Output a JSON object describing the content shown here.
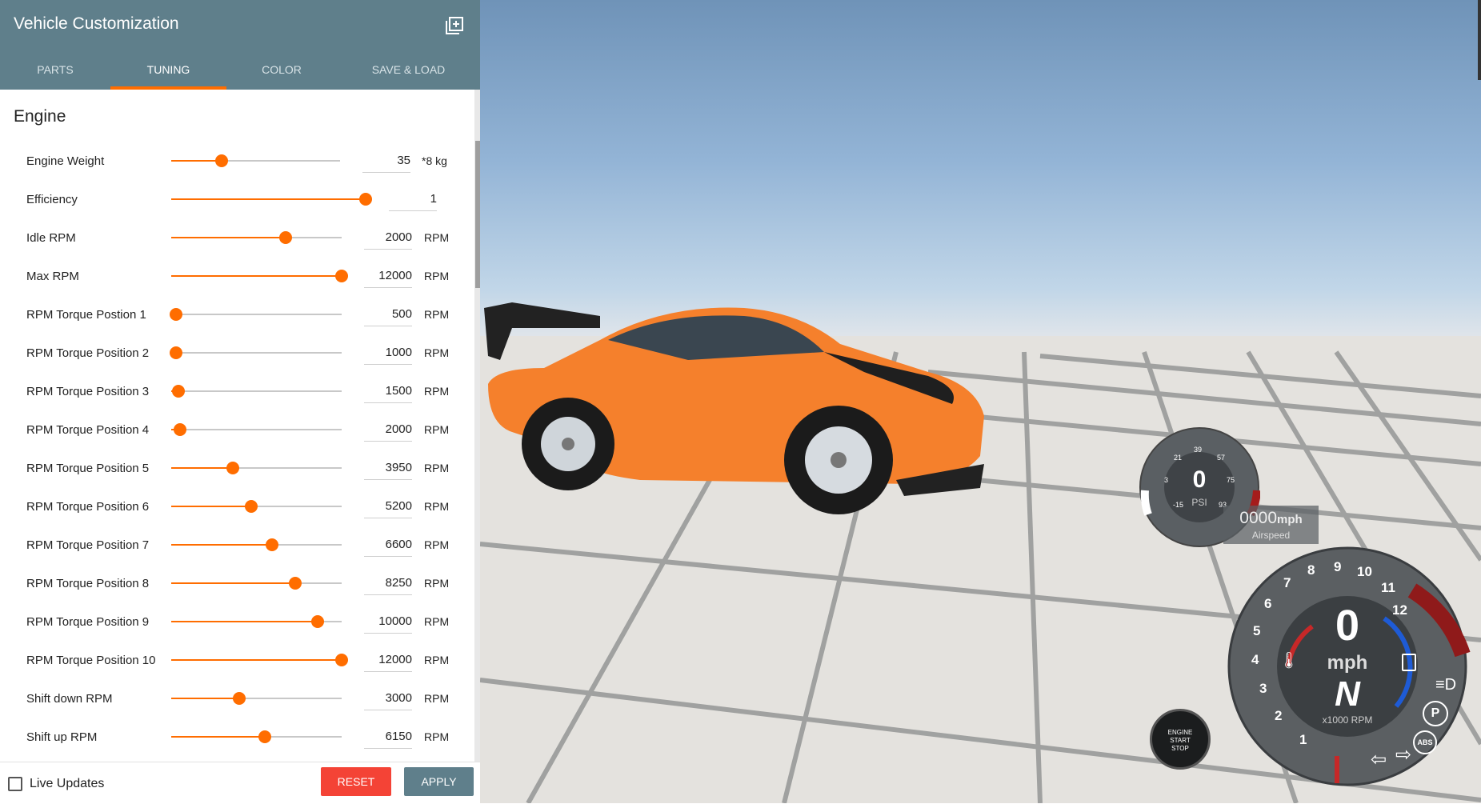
{
  "panel": {
    "title": "Vehicle Customization",
    "header_icon": "add-window-icon",
    "tabs": [
      {
        "label": "PARTS",
        "active": false
      },
      {
        "label": "TUNING",
        "active": true
      },
      {
        "label": "COLOR",
        "active": false
      },
      {
        "label": "SAVE & LOAD",
        "active": false
      }
    ],
    "section_title": "Engine",
    "accent_color": "#ff6d00",
    "header_color": "#5f7f8b",
    "settings": [
      {
        "label": "Engine Weight",
        "value": "35",
        "unit": "*8 kg",
        "level": 0.3
      },
      {
        "label": "Efficiency",
        "value": "1",
        "unit": "",
        "level": 1.0
      },
      {
        "label": "Idle RPM",
        "value": "2000",
        "unit": "RPM",
        "level": 0.67
      },
      {
        "label": "Max RPM",
        "value": "12000",
        "unit": "RPM",
        "level": 1.0
      },
      {
        "label": "RPM Torque Postion 1",
        "value": "500",
        "unit": "RPM",
        "level": 0.03
      },
      {
        "label": "RPM Torque Position 2",
        "value": "1000",
        "unit": "RPM",
        "level": 0.03
      },
      {
        "label": "RPM Torque Position 3",
        "value": "1500",
        "unit": "RPM",
        "level": 0.04
      },
      {
        "label": "RPM Torque Position 4",
        "value": "2000",
        "unit": "RPM",
        "level": 0.05
      },
      {
        "label": "RPM Torque Position 5",
        "value": "3950",
        "unit": "RPM",
        "level": 0.36
      },
      {
        "label": "RPM Torque Position 6",
        "value": "5200",
        "unit": "RPM",
        "level": 0.47
      },
      {
        "label": "RPM Torque Position 7",
        "value": "6600",
        "unit": "RPM",
        "level": 0.59
      },
      {
        "label": "RPM Torque Position 8",
        "value": "8250",
        "unit": "RPM",
        "level": 0.73
      },
      {
        "label": "RPM Torque Position 9",
        "value": "10000",
        "unit": "RPM",
        "level": 0.86
      },
      {
        "label": "RPM Torque Position 10",
        "value": "12000",
        "unit": "RPM",
        "level": 1.0
      },
      {
        "label": "Shift down RPM",
        "value": "3000",
        "unit": "RPM",
        "level": 0.4
      },
      {
        "label": "Shift up RPM",
        "value": "6150",
        "unit": "RPM",
        "level": 0.55
      }
    ],
    "live_updates_label": "Live Updates",
    "live_updates_checked": false,
    "reset_label": "RESET",
    "apply_label": "APPLY",
    "reset_color": "#f44336"
  },
  "hud": {
    "airspeed_value": "0000",
    "airspeed_unit": "mph",
    "airspeed_label": "Airspeed",
    "boost": {
      "value": "0",
      "unit": "PSI",
      "ticks": [
        "-15",
        "3",
        "21",
        "39",
        "57",
        "75",
        "93"
      ]
    },
    "speedometer": {
      "speed": "0",
      "unit": "mph",
      "gear": "N",
      "rpm_label": "x1000 RPM",
      "rpm_ticks": [
        "1",
        "2",
        "3",
        "4",
        "5",
        "6",
        "7",
        "8",
        "9",
        "10",
        "11",
        "12"
      ]
    },
    "engine_button": {
      "line1": "ENGINE",
      "line2": "START",
      "line3": "STOP"
    },
    "icons": [
      "parking-brake-icon",
      "abs-icon",
      "headlight-icon",
      "fuel-icon",
      "temperature-icon",
      "turn-left-icon",
      "turn-right-icon"
    ],
    "parking_label": "P",
    "abs_label": "ABS"
  }
}
